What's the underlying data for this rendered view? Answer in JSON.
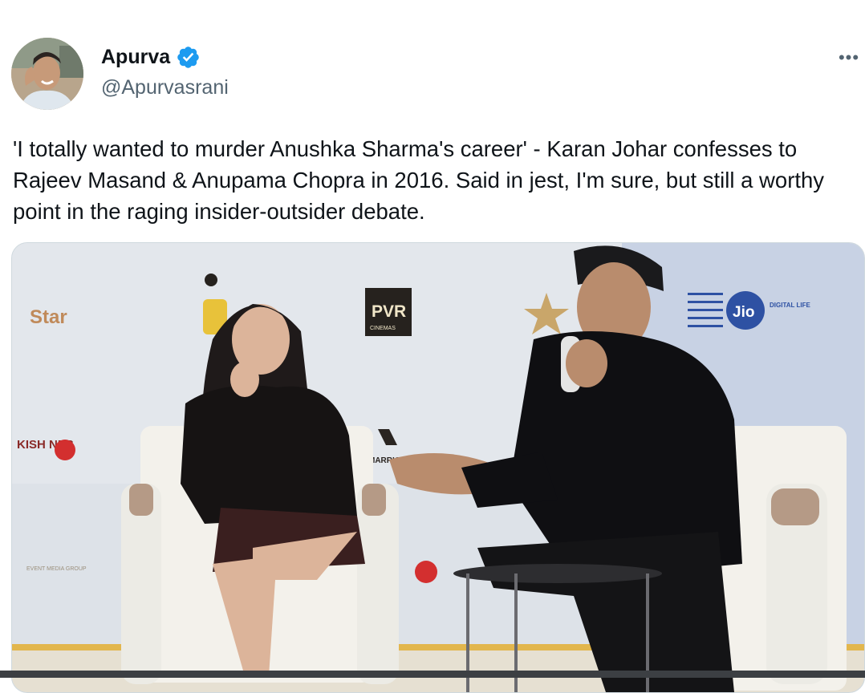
{
  "author": {
    "display_name": "Apurva",
    "handle": "@Apurvasrani",
    "verified": true,
    "verified_icon": "verified-badge-icon",
    "avatar_icon": "avatar"
  },
  "tweet": {
    "text": "'I totally wanted to murder Anushka Sharma's career' - Karan Johar confesses to Rajeev Masand & Anupama Chopra in 2016. Said in jest, I'm sure, but still a worthy point in the raging insider-outsider debate."
  },
  "actions": {
    "more_icon": "more-options-icon",
    "more_label": "•••"
  },
  "media": {
    "backdrop_logos": {
      "star": "Star",
      "pvr": "PVR",
      "pvr_sub": "CINEMAS",
      "jio": "Jio",
      "jio_sub": "DIGITAL LIFE",
      "airline_left": "KISH NES",
      "marrow": "MARRIO",
      "event": "EVENT MEDIA GROUP"
    }
  },
  "colors": {
    "verified": "#1d9bf0",
    "text": "#0f1419",
    "secondary_text": "#536471",
    "backdrop": "#d9dfe6",
    "chair": "#f2f0ea",
    "jio_blue": "#2e51a3"
  }
}
